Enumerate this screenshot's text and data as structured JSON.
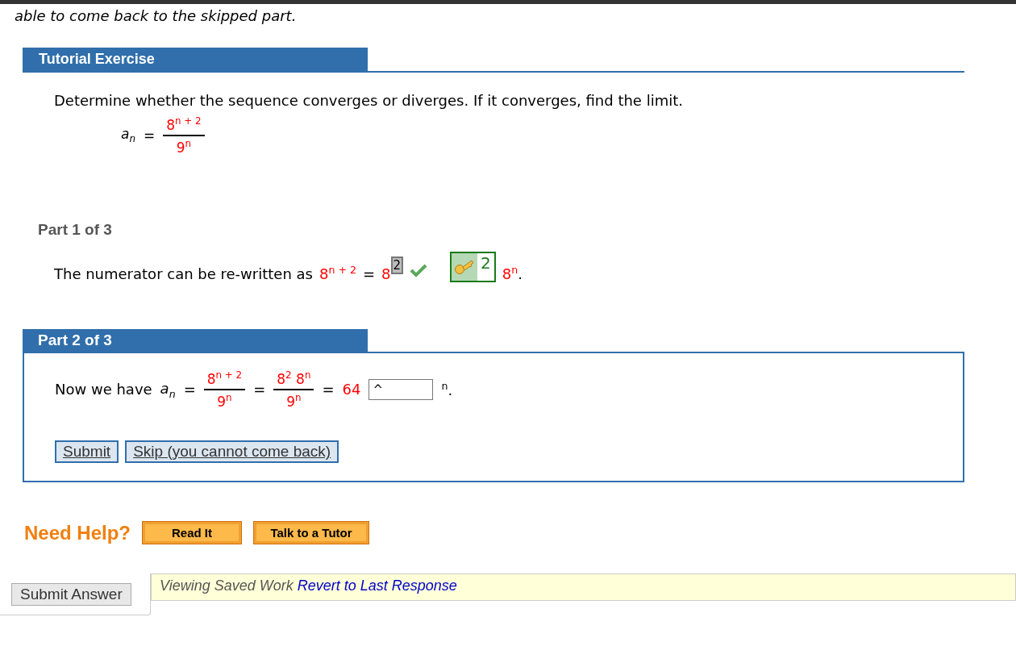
{
  "intro_text": "able to come back to the skipped part.",
  "tutorial": {
    "title": "Tutorial Exercise",
    "question": "Determine whether the sequence converges or diverges. If it converges, find the limit.",
    "formula": {
      "lhs": "a$_{n}$",
      "eq": "=",
      "numerator": "8$^{n + 2}$",
      "denominator": "9$^{n}$"
    }
  },
  "part1": {
    "label": "Part 1 of 3",
    "sentence": "The numerator can be re-written as",
    "expr": "8$^{n + 2}$",
    "eq": "=",
    "base": "8",
    "answer": "2",
    "correct": true,
    "hint_count": "2",
    "tail": "8$^{n}$",
    "period": "."
  },
  "part2": {
    "label": "Part 2 of 3",
    "sentence": "Now we have",
    "lhs": "a$_{n}$",
    "eq": "=",
    "fractions": [
      {
        "numerator": "8$^{n + 2}$",
        "denominator": "9$^{n}$"
      },
      {
        "numerator": "8$^{2}$ 8$^{n}$",
        "denominator": "9$^{n}$"
      }
    ],
    "result": "64",
    "input_value": "^",
    "tail": "$^{n}$.",
    "buttons": [
      "Submit",
      "Skip (you cannot come back)"
    ]
  },
  "help": {
    "label": "Need Help?",
    "buttons": [
      "Read It",
      "Talk to a Tutor"
    ]
  },
  "footer": {
    "submit": "Submit Answer",
    "status": "Viewing Saved Work",
    "link": "Revert to Last Response"
  }
}
